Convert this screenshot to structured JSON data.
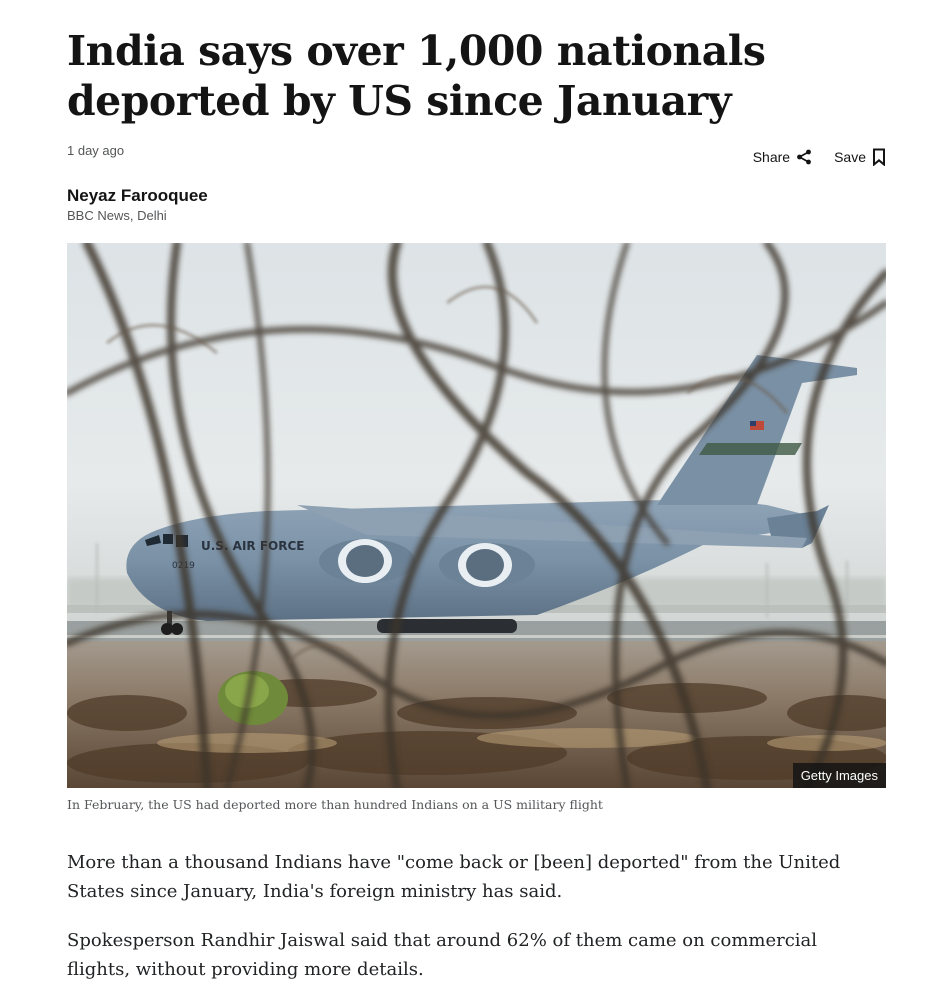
{
  "article": {
    "headline": "India says over 1,000 nationals deported by US since January",
    "timestamp": "1 day ago",
    "actions": {
      "share_label": "Share",
      "save_label": "Save"
    },
    "byline": {
      "author": "Neyaz Farooquee",
      "organization": "BBC News, Delhi"
    },
    "image": {
      "credit": "Getty Images",
      "caption": "In February, the US had deported more than hundred Indians on a US military flight",
      "aircraft_marking": "U.S. AIR FORCE",
      "tail_number": "0219"
    },
    "paragraphs": [
      "More than a thousand Indians have \"come back or [been] deported\" from the United States since January, India's foreign ministry has said.",
      "Spokesperson Randhir Jaiswal said that around 62% of them came on commercial flights, without providing more details."
    ]
  },
  "icons": {
    "share": "share-icon",
    "save": "bookmark-icon"
  },
  "colors": {
    "text": "#141414",
    "meta": "#545658",
    "credit_bg": "#141414"
  }
}
